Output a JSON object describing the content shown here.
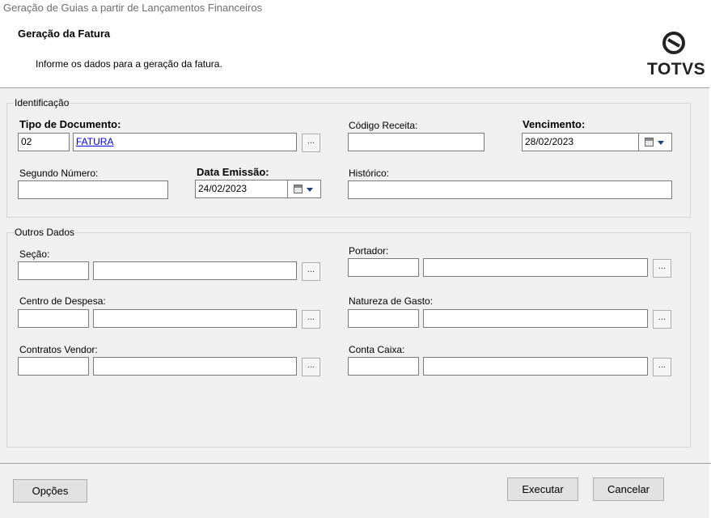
{
  "window": {
    "title": "Geração de Guias a partir de Lançamentos Financeiros"
  },
  "header": {
    "title": "Geração da Fatura",
    "subtitle": "Informe os dados para a geração da fatura.",
    "logo_text": "TOTVS",
    "logo_icon": "totvs-logo-icon"
  },
  "identificacao": {
    "legend": "Identificação",
    "tipo_documento": {
      "label": "Tipo de Documento:",
      "code": "02",
      "description": "FATURA"
    },
    "codigo_receita": {
      "label": "Código Receita:",
      "value": ""
    },
    "vencimento": {
      "label": "Vencimento:",
      "value": "28/02/2023"
    },
    "segundo_numero": {
      "label": "Segundo Número:",
      "value": ""
    },
    "data_emissao": {
      "label": "Data Emissão:",
      "value": "24/02/2023"
    },
    "historico": {
      "label": "Histórico:",
      "value": ""
    }
  },
  "outros": {
    "legend": "Outros Dados",
    "secao": {
      "label": "Seção:"
    },
    "portador": {
      "label": "Portador:"
    },
    "centro_despesa": {
      "label": "Centro de Despesa:"
    },
    "natureza_gasto": {
      "label": "Natureza de Gasto:"
    },
    "contratos_vendor": {
      "label": "Contratos Vendor:"
    },
    "conta_caixa": {
      "label": "Conta Caixa:"
    }
  },
  "common": {
    "ellipsis": "..."
  },
  "footer": {
    "opcoes": "Opções",
    "executar": "Executar",
    "cancelar": "Cancelar"
  }
}
